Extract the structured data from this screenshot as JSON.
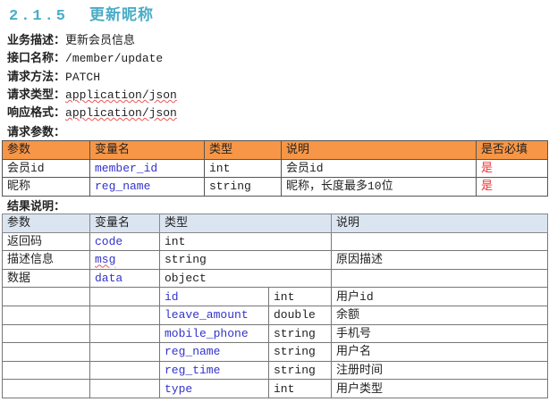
{
  "heading": {
    "number": "2.1.5",
    "title": "更新昵称"
  },
  "meta": [
    {
      "label": "业务描述：",
      "value": "更新会员信息"
    },
    {
      "label": "接口名称：",
      "value": "/member/update"
    },
    {
      "label": "请求方法：",
      "value": "PATCH"
    },
    {
      "label": "请求类型：",
      "value": "application/json"
    },
    {
      "label": "响应格式：",
      "value": "application/json"
    }
  ],
  "request_label": "请求参数：",
  "request_table": {
    "headers": [
      "参数",
      "变量名",
      "类型",
      "说明",
      "是否必填"
    ],
    "rows": [
      [
        "会员id",
        "member_id",
        "int",
        "会员id",
        "是"
      ],
      [
        "昵称",
        "reg_name",
        "string",
        "昵称，长度最多10位",
        "是"
      ]
    ]
  },
  "result_label": "结果说明：",
  "result_table": {
    "headers": [
      "参数",
      "变量名",
      "类型",
      "说明"
    ],
    "rows": [
      [
        "返回码",
        "code",
        "int",
        ""
      ],
      [
        "描述信息",
        "msg",
        "string",
        "原因描述"
      ],
      [
        "数据",
        "data",
        "object",
        ""
      ]
    ],
    "data_fields": [
      [
        "id",
        "int",
        "用户id"
      ],
      [
        "leave_amount",
        "double",
        "余额"
      ],
      [
        "mobile_phone",
        "string",
        "手机号"
      ],
      [
        "reg_name",
        "string",
        "用户名"
      ],
      [
        "reg_time",
        "string",
        "注册时间"
      ],
      [
        "type",
        "int",
        "用户类型"
      ]
    ]
  }
}
